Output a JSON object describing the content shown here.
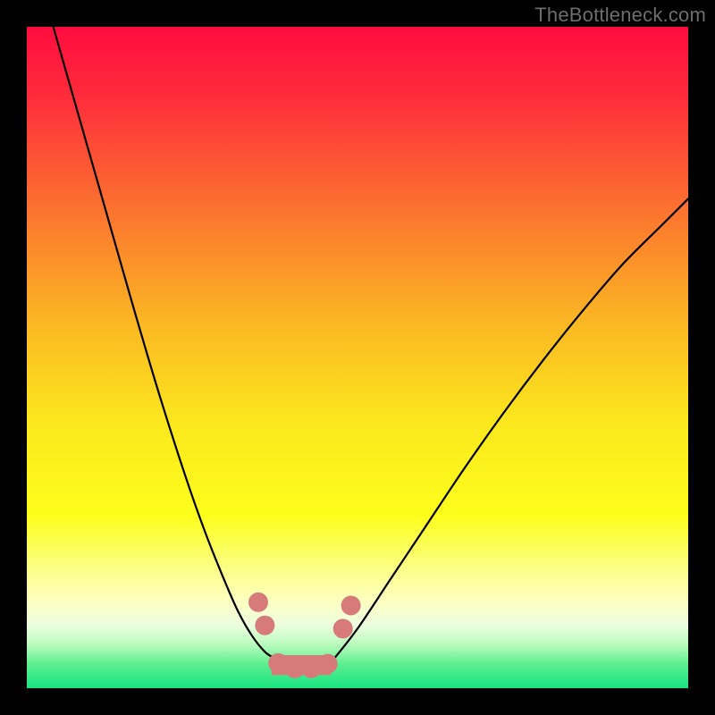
{
  "watermark": "TheBottleneck.com",
  "chart_data": {
    "type": "line",
    "title": "",
    "xlabel": "",
    "ylabel": "",
    "xlim": [
      0,
      1
    ],
    "ylim": [
      0,
      1
    ],
    "background_gradient_stops": [
      {
        "pos": 0.0,
        "color": "#ff0c3f"
      },
      {
        "pos": 0.1,
        "color": "#ff2a3c"
      },
      {
        "pos": 0.25,
        "color": "#fc6831"
      },
      {
        "pos": 0.45,
        "color": "#fbb823"
      },
      {
        "pos": 0.6,
        "color": "#fbe81d"
      },
      {
        "pos": 0.74,
        "color": "#fdfe1c"
      },
      {
        "pos": 0.82,
        "color": "#fcff87"
      },
      {
        "pos": 0.87,
        "color": "#fdffc2"
      },
      {
        "pos": 0.905,
        "color": "#ecfee0"
      },
      {
        "pos": 0.935,
        "color": "#b7fbbb"
      },
      {
        "pos": 0.965,
        "color": "#59ee8f"
      },
      {
        "pos": 1.0,
        "color": "#19e582"
      }
    ],
    "series": [
      {
        "name": "left-branch",
        "stroke": "#000000",
        "stroke_width": 2.2,
        "x": [
          0.04,
          0.08,
          0.12,
          0.16,
          0.2,
          0.24,
          0.27,
          0.3,
          0.32,
          0.34,
          0.36,
          0.375
        ],
        "y": [
          0.0,
          0.14,
          0.28,
          0.42,
          0.555,
          0.68,
          0.765,
          0.84,
          0.885,
          0.92,
          0.945,
          0.955
        ]
      },
      {
        "name": "valley-floor",
        "stroke": "#000000",
        "stroke_width": 2.2,
        "x": [
          0.375,
          0.395,
          0.42,
          0.445,
          0.465
        ],
        "y": [
          0.955,
          0.965,
          0.966,
          0.964,
          0.955
        ]
      },
      {
        "name": "right-branch",
        "stroke": "#000000",
        "stroke_width": 2.2,
        "x": [
          0.465,
          0.5,
          0.55,
          0.6,
          0.66,
          0.72,
          0.78,
          0.84,
          0.9,
          0.96,
          1.0
        ],
        "y": [
          0.955,
          0.91,
          0.835,
          0.76,
          0.67,
          0.585,
          0.505,
          0.43,
          0.36,
          0.3,
          0.26
        ]
      }
    ],
    "markers": {
      "name": "valley-markers",
      "fill": "#d77b7a",
      "r": 11,
      "points": [
        {
          "x": 0.35,
          "y": 0.87
        },
        {
          "x": 0.36,
          "y": 0.905
        },
        {
          "x": 0.38,
          "y": 0.962
        },
        {
          "x": 0.405,
          "y": 0.97
        },
        {
          "x": 0.43,
          "y": 0.97
        },
        {
          "x": 0.455,
          "y": 0.963
        },
        {
          "x": 0.478,
          "y": 0.91
        },
        {
          "x": 0.49,
          "y": 0.875
        }
      ]
    },
    "valley_band": {
      "fill": "#d77b7a",
      "points": [
        {
          "x": 0.37,
          "y": 0.95
        },
        {
          "x": 0.46,
          "y": 0.95
        },
        {
          "x": 0.46,
          "y": 0.98
        },
        {
          "x": 0.37,
          "y": 0.98
        }
      ]
    }
  }
}
